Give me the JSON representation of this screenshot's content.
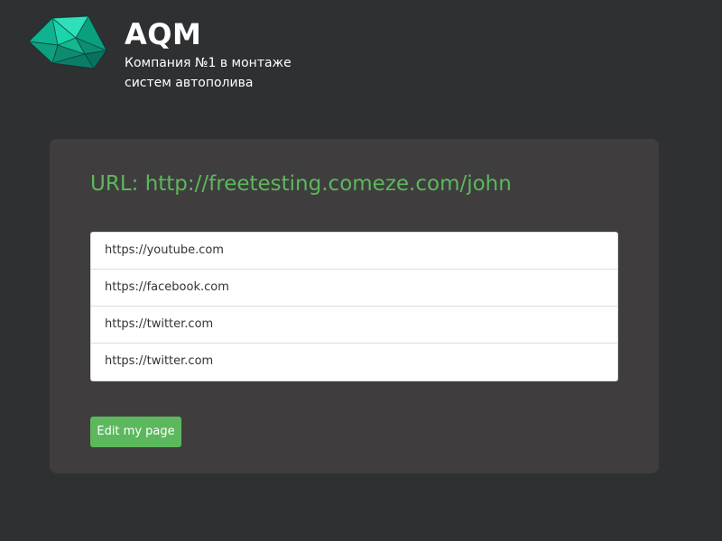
{
  "brand": {
    "name": "AQM",
    "tagline": "Компания №1 в монтаже систем автополива",
    "logo_icon": "gem-logo-icon"
  },
  "page": {
    "url_title": "URL: http://freetesting.comeze.com/john"
  },
  "links": [
    {
      "url": "https://youtube.com"
    },
    {
      "url": "https://facebook.com"
    },
    {
      "url": "https://twitter.com"
    },
    {
      "url": "https://twitter.com"
    }
  ],
  "actions": {
    "edit_label": "Edit my page"
  },
  "colors": {
    "background": "#2f3032",
    "panel": "#3f3d3e",
    "accent": "#5cb85c",
    "text_light": "#ffffff"
  }
}
